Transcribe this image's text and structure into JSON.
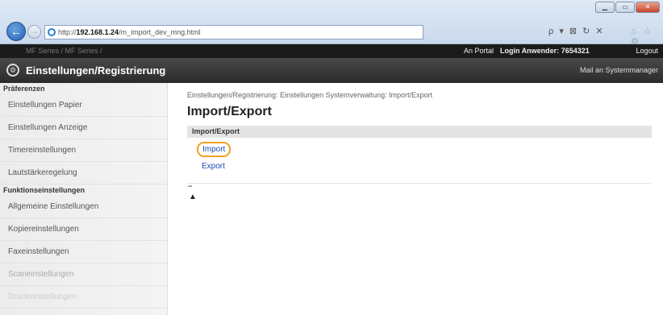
{
  "browser": {
    "url_prefix": "http://",
    "url_host": "192.168.1.24",
    "url_path": "/m_import_dev_mng.html",
    "addr_tools": "ρ ▾ ⊠ ↻ ✕",
    "right_tools": "⌂ ☆ ⚙"
  },
  "topbar": {
    "device_name": "MF Series / MF Series /",
    "portal_link": "An Portal",
    "login_label": "Login Anwender:",
    "login_user": "7654321",
    "logout_link": "Logout"
  },
  "header": {
    "title": "Einstellungen/Registrierung",
    "mail_link": "Mail an Systemmanager"
  },
  "sidebar": {
    "section1": "Präferenzen",
    "items1": [
      "Einstellungen Papier",
      "Einstellungen Anzeige",
      "Timereinstellungen",
      "Lautstärkeregelung"
    ],
    "section2": "Funktionseinstellungen",
    "items2": [
      "Allgemeine Einstellungen",
      "Kopiereinstellungen",
      "Faxeinstellungen",
      "Scaneinstellungen",
      "Druckeinstellungen"
    ]
  },
  "main": {
    "breadcrumb": "Einstellungen/Registrierung: Einstellungen Systemverwaltung: Import/Export",
    "page_title": "Import/Export",
    "panel_title": "Import/Export",
    "link_import": "Import",
    "link_export": "Export",
    "top_icon": "▲"
  }
}
